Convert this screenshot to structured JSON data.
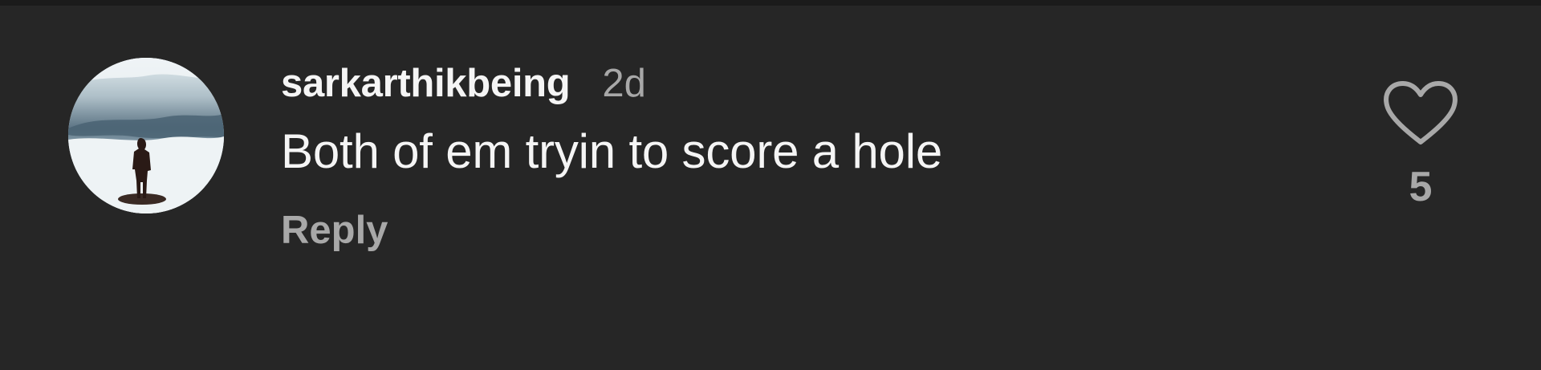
{
  "comment": {
    "username": "sarkarthikbeing",
    "time": "2d",
    "text": "Both of em tryin to score a hole",
    "reply_label": "Reply",
    "like_count": "5"
  },
  "icons": {
    "like": "heart-outline-icon",
    "avatar": "profile-photo"
  },
  "colors": {
    "background": "#262626",
    "primary_text": "#f5f5f5",
    "secondary_text": "#a8a8a8"
  }
}
